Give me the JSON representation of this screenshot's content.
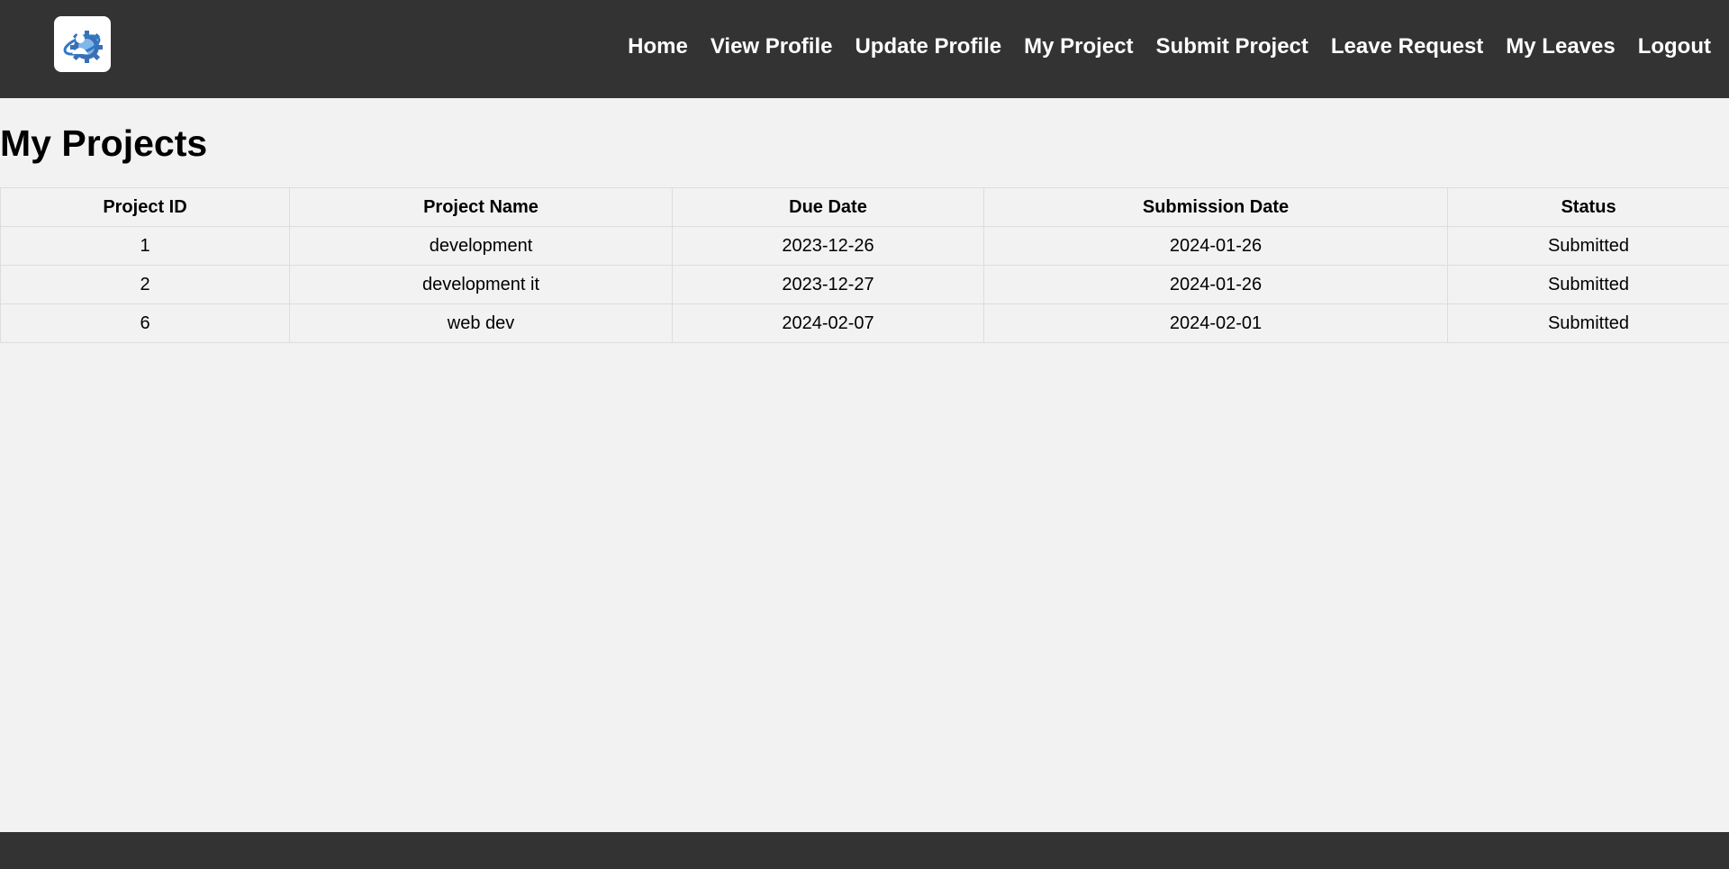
{
  "nav": {
    "items": [
      "Home",
      "View Profile",
      "Update Profile",
      "My Project",
      "Submit Project",
      "Leave Request",
      "My Leaves",
      "Logout"
    ]
  },
  "page": {
    "title": "My Projects"
  },
  "table": {
    "headers": [
      "Project ID",
      "Project Name",
      "Due Date",
      "Submission Date",
      "Status"
    ],
    "rows": [
      [
        "1",
        "development",
        "2023-12-26",
        "2024-01-26",
        "Submitted"
      ],
      [
        "2",
        "development it",
        "2023-12-27",
        "2024-01-26",
        "Submitted"
      ],
      [
        "6",
        "web dev",
        "2024-02-07",
        "2024-02-01",
        "Submitted"
      ]
    ]
  },
  "icons": {
    "logo": "user-gear-logo-icon"
  },
  "colors": {
    "header_bg": "#333333",
    "page_bg": "#f2f2f2",
    "nav_text": "#ffffff",
    "logo_blue": "#2f78c4"
  }
}
